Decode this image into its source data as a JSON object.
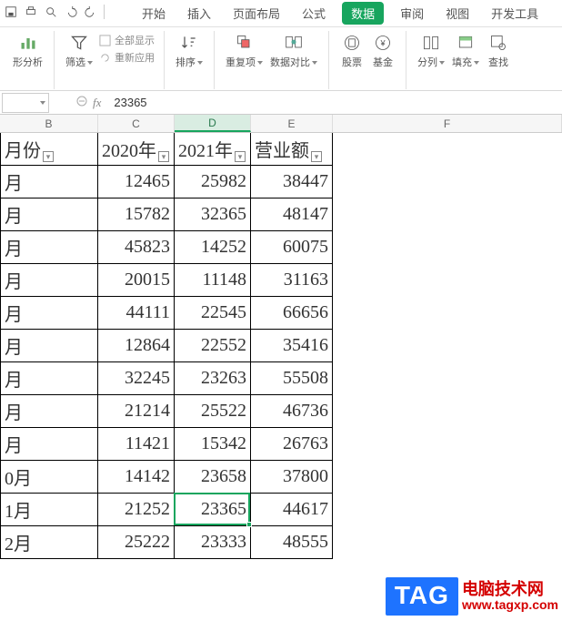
{
  "tabs": {
    "start": "开始",
    "insert": "插入",
    "layout": "页面布局",
    "formula": "公式",
    "data": "数据",
    "review": "审阅",
    "view": "视图",
    "dev": "开发工具"
  },
  "toolbar": {
    "analysis": "形分析",
    "filter": "筛选",
    "show_all": "全部显示",
    "reapply": "重新应用",
    "sort": "排序",
    "duplicates": "重复项",
    "data_compare": "数据对比",
    "stocks": "股票",
    "fund": "基金",
    "split": "分列",
    "fill": "填充",
    "lookup": "查找"
  },
  "formula_bar": {
    "value": "23365"
  },
  "columns": {
    "B": "B",
    "C": "C",
    "D": "D",
    "E": "E",
    "F": "F"
  },
  "headers": {
    "month": "月份",
    "y2020": "2020年",
    "y2021": "2021年",
    "rev": "营业额"
  },
  "rows": [
    {
      "m": "月",
      "c": "12465",
      "d": "25982",
      "e": "38447"
    },
    {
      "m": "月",
      "c": "15782",
      "d": "32365",
      "e": "48147"
    },
    {
      "m": "月",
      "c": "45823",
      "d": "14252",
      "e": "60075"
    },
    {
      "m": "月",
      "c": "20015",
      "d": "11148",
      "e": "31163"
    },
    {
      "m": "月",
      "c": "44111",
      "d": "22545",
      "e": "66656"
    },
    {
      "m": "月",
      "c": "12864",
      "d": "22552",
      "e": "35416"
    },
    {
      "m": "月",
      "c": "32245",
      "d": "23263",
      "e": "55508"
    },
    {
      "m": "月",
      "c": "21214",
      "d": "25522",
      "e": "46736"
    },
    {
      "m": "月",
      "c": "11421",
      "d": "15342",
      "e": "26763"
    },
    {
      "m": "0月",
      "c": "14142",
      "d": "23658",
      "e": "37800"
    },
    {
      "m": "1月",
      "c": "21252",
      "d": "23365",
      "e": "44617"
    },
    {
      "m": "2月",
      "c": "25222",
      "d": "23333",
      "e": "48555"
    }
  ],
  "overlay": {
    "tag": "TAG",
    "cn": "电脑技术网",
    "url": "www.tagxp.com"
  }
}
